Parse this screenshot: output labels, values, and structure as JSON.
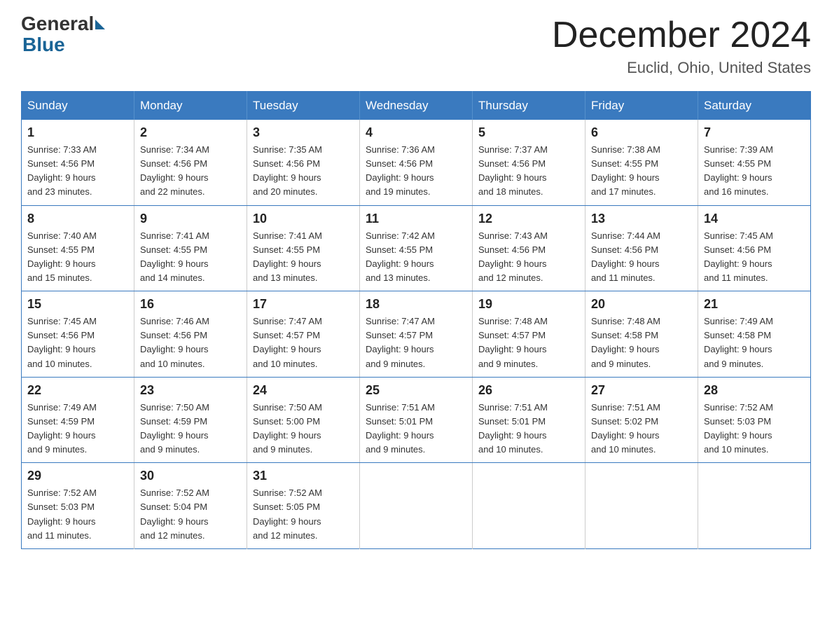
{
  "logo": {
    "general": "General",
    "blue": "Blue"
  },
  "title": {
    "month": "December 2024",
    "location": "Euclid, Ohio, United States"
  },
  "weekdays": [
    "Sunday",
    "Monday",
    "Tuesday",
    "Wednesday",
    "Thursday",
    "Friday",
    "Saturday"
  ],
  "weeks": [
    [
      {
        "day": "1",
        "sunrise": "7:33 AM",
        "sunset": "4:56 PM",
        "daylight": "9 hours and 23 minutes."
      },
      {
        "day": "2",
        "sunrise": "7:34 AM",
        "sunset": "4:56 PM",
        "daylight": "9 hours and 22 minutes."
      },
      {
        "day": "3",
        "sunrise": "7:35 AM",
        "sunset": "4:56 PM",
        "daylight": "9 hours and 20 minutes."
      },
      {
        "day": "4",
        "sunrise": "7:36 AM",
        "sunset": "4:56 PM",
        "daylight": "9 hours and 19 minutes."
      },
      {
        "day": "5",
        "sunrise": "7:37 AM",
        "sunset": "4:56 PM",
        "daylight": "9 hours and 18 minutes."
      },
      {
        "day": "6",
        "sunrise": "7:38 AM",
        "sunset": "4:55 PM",
        "daylight": "9 hours and 17 minutes."
      },
      {
        "day": "7",
        "sunrise": "7:39 AM",
        "sunset": "4:55 PM",
        "daylight": "9 hours and 16 minutes."
      }
    ],
    [
      {
        "day": "8",
        "sunrise": "7:40 AM",
        "sunset": "4:55 PM",
        "daylight": "9 hours and 15 minutes."
      },
      {
        "day": "9",
        "sunrise": "7:41 AM",
        "sunset": "4:55 PM",
        "daylight": "9 hours and 14 minutes."
      },
      {
        "day": "10",
        "sunrise": "7:41 AM",
        "sunset": "4:55 PM",
        "daylight": "9 hours and 13 minutes."
      },
      {
        "day": "11",
        "sunrise": "7:42 AM",
        "sunset": "4:55 PM",
        "daylight": "9 hours and 13 minutes."
      },
      {
        "day": "12",
        "sunrise": "7:43 AM",
        "sunset": "4:56 PM",
        "daylight": "9 hours and 12 minutes."
      },
      {
        "day": "13",
        "sunrise": "7:44 AM",
        "sunset": "4:56 PM",
        "daylight": "9 hours and 11 minutes."
      },
      {
        "day": "14",
        "sunrise": "7:45 AM",
        "sunset": "4:56 PM",
        "daylight": "9 hours and 11 minutes."
      }
    ],
    [
      {
        "day": "15",
        "sunrise": "7:45 AM",
        "sunset": "4:56 PM",
        "daylight": "9 hours and 10 minutes."
      },
      {
        "day": "16",
        "sunrise": "7:46 AM",
        "sunset": "4:56 PM",
        "daylight": "9 hours and 10 minutes."
      },
      {
        "day": "17",
        "sunrise": "7:47 AM",
        "sunset": "4:57 PM",
        "daylight": "9 hours and 10 minutes."
      },
      {
        "day": "18",
        "sunrise": "7:47 AM",
        "sunset": "4:57 PM",
        "daylight": "9 hours and 9 minutes."
      },
      {
        "day": "19",
        "sunrise": "7:48 AM",
        "sunset": "4:57 PM",
        "daylight": "9 hours and 9 minutes."
      },
      {
        "day": "20",
        "sunrise": "7:48 AM",
        "sunset": "4:58 PM",
        "daylight": "9 hours and 9 minutes."
      },
      {
        "day": "21",
        "sunrise": "7:49 AM",
        "sunset": "4:58 PM",
        "daylight": "9 hours and 9 minutes."
      }
    ],
    [
      {
        "day": "22",
        "sunrise": "7:49 AM",
        "sunset": "4:59 PM",
        "daylight": "9 hours and 9 minutes."
      },
      {
        "day": "23",
        "sunrise": "7:50 AM",
        "sunset": "4:59 PM",
        "daylight": "9 hours and 9 minutes."
      },
      {
        "day": "24",
        "sunrise": "7:50 AM",
        "sunset": "5:00 PM",
        "daylight": "9 hours and 9 minutes."
      },
      {
        "day": "25",
        "sunrise": "7:51 AM",
        "sunset": "5:01 PM",
        "daylight": "9 hours and 9 minutes."
      },
      {
        "day": "26",
        "sunrise": "7:51 AM",
        "sunset": "5:01 PM",
        "daylight": "9 hours and 10 minutes."
      },
      {
        "day": "27",
        "sunrise": "7:51 AM",
        "sunset": "5:02 PM",
        "daylight": "9 hours and 10 minutes."
      },
      {
        "day": "28",
        "sunrise": "7:52 AM",
        "sunset": "5:03 PM",
        "daylight": "9 hours and 10 minutes."
      }
    ],
    [
      {
        "day": "29",
        "sunrise": "7:52 AM",
        "sunset": "5:03 PM",
        "daylight": "9 hours and 11 minutes."
      },
      {
        "day": "30",
        "sunrise": "7:52 AM",
        "sunset": "5:04 PM",
        "daylight": "9 hours and 12 minutes."
      },
      {
        "day": "31",
        "sunrise": "7:52 AM",
        "sunset": "5:05 PM",
        "daylight": "9 hours and 12 minutes."
      },
      null,
      null,
      null,
      null
    ]
  ],
  "labels": {
    "sunrise": "Sunrise:",
    "sunset": "Sunset:",
    "daylight": "Daylight:"
  }
}
